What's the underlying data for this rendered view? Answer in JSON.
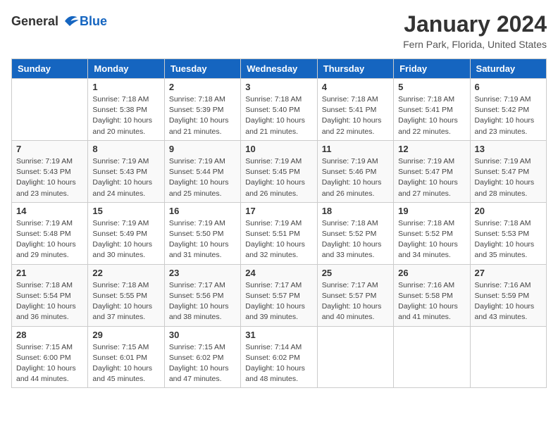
{
  "logo": {
    "general": "General",
    "blue": "Blue"
  },
  "title": "January 2024",
  "location": "Fern Park, Florida, United States",
  "days_of_week": [
    "Sunday",
    "Monday",
    "Tuesday",
    "Wednesday",
    "Thursday",
    "Friday",
    "Saturday"
  ],
  "weeks": [
    [
      {
        "day": "",
        "info": ""
      },
      {
        "day": "1",
        "info": "Sunrise: 7:18 AM\nSunset: 5:38 PM\nDaylight: 10 hours\nand 20 minutes."
      },
      {
        "day": "2",
        "info": "Sunrise: 7:18 AM\nSunset: 5:39 PM\nDaylight: 10 hours\nand 21 minutes."
      },
      {
        "day": "3",
        "info": "Sunrise: 7:18 AM\nSunset: 5:40 PM\nDaylight: 10 hours\nand 21 minutes."
      },
      {
        "day": "4",
        "info": "Sunrise: 7:18 AM\nSunset: 5:41 PM\nDaylight: 10 hours\nand 22 minutes."
      },
      {
        "day": "5",
        "info": "Sunrise: 7:18 AM\nSunset: 5:41 PM\nDaylight: 10 hours\nand 22 minutes."
      },
      {
        "day": "6",
        "info": "Sunrise: 7:19 AM\nSunset: 5:42 PM\nDaylight: 10 hours\nand 23 minutes."
      }
    ],
    [
      {
        "day": "7",
        "info": "Sunrise: 7:19 AM\nSunset: 5:43 PM\nDaylight: 10 hours\nand 23 minutes."
      },
      {
        "day": "8",
        "info": "Sunrise: 7:19 AM\nSunset: 5:43 PM\nDaylight: 10 hours\nand 24 minutes."
      },
      {
        "day": "9",
        "info": "Sunrise: 7:19 AM\nSunset: 5:44 PM\nDaylight: 10 hours\nand 25 minutes."
      },
      {
        "day": "10",
        "info": "Sunrise: 7:19 AM\nSunset: 5:45 PM\nDaylight: 10 hours\nand 26 minutes."
      },
      {
        "day": "11",
        "info": "Sunrise: 7:19 AM\nSunset: 5:46 PM\nDaylight: 10 hours\nand 26 minutes."
      },
      {
        "day": "12",
        "info": "Sunrise: 7:19 AM\nSunset: 5:47 PM\nDaylight: 10 hours\nand 27 minutes."
      },
      {
        "day": "13",
        "info": "Sunrise: 7:19 AM\nSunset: 5:47 PM\nDaylight: 10 hours\nand 28 minutes."
      }
    ],
    [
      {
        "day": "14",
        "info": "Sunrise: 7:19 AM\nSunset: 5:48 PM\nDaylight: 10 hours\nand 29 minutes."
      },
      {
        "day": "15",
        "info": "Sunrise: 7:19 AM\nSunset: 5:49 PM\nDaylight: 10 hours\nand 30 minutes."
      },
      {
        "day": "16",
        "info": "Sunrise: 7:19 AM\nSunset: 5:50 PM\nDaylight: 10 hours\nand 31 minutes."
      },
      {
        "day": "17",
        "info": "Sunrise: 7:19 AM\nSunset: 5:51 PM\nDaylight: 10 hours\nand 32 minutes."
      },
      {
        "day": "18",
        "info": "Sunrise: 7:18 AM\nSunset: 5:52 PM\nDaylight: 10 hours\nand 33 minutes."
      },
      {
        "day": "19",
        "info": "Sunrise: 7:18 AM\nSunset: 5:52 PM\nDaylight: 10 hours\nand 34 minutes."
      },
      {
        "day": "20",
        "info": "Sunrise: 7:18 AM\nSunset: 5:53 PM\nDaylight: 10 hours\nand 35 minutes."
      }
    ],
    [
      {
        "day": "21",
        "info": "Sunrise: 7:18 AM\nSunset: 5:54 PM\nDaylight: 10 hours\nand 36 minutes."
      },
      {
        "day": "22",
        "info": "Sunrise: 7:18 AM\nSunset: 5:55 PM\nDaylight: 10 hours\nand 37 minutes."
      },
      {
        "day": "23",
        "info": "Sunrise: 7:17 AM\nSunset: 5:56 PM\nDaylight: 10 hours\nand 38 minutes."
      },
      {
        "day": "24",
        "info": "Sunrise: 7:17 AM\nSunset: 5:57 PM\nDaylight: 10 hours\nand 39 minutes."
      },
      {
        "day": "25",
        "info": "Sunrise: 7:17 AM\nSunset: 5:57 PM\nDaylight: 10 hours\nand 40 minutes."
      },
      {
        "day": "26",
        "info": "Sunrise: 7:16 AM\nSunset: 5:58 PM\nDaylight: 10 hours\nand 41 minutes."
      },
      {
        "day": "27",
        "info": "Sunrise: 7:16 AM\nSunset: 5:59 PM\nDaylight: 10 hours\nand 43 minutes."
      }
    ],
    [
      {
        "day": "28",
        "info": "Sunrise: 7:15 AM\nSunset: 6:00 PM\nDaylight: 10 hours\nand 44 minutes."
      },
      {
        "day": "29",
        "info": "Sunrise: 7:15 AM\nSunset: 6:01 PM\nDaylight: 10 hours\nand 45 minutes."
      },
      {
        "day": "30",
        "info": "Sunrise: 7:15 AM\nSunset: 6:02 PM\nDaylight: 10 hours\nand 47 minutes."
      },
      {
        "day": "31",
        "info": "Sunrise: 7:14 AM\nSunset: 6:02 PM\nDaylight: 10 hours\nand 48 minutes."
      },
      {
        "day": "",
        "info": ""
      },
      {
        "day": "",
        "info": ""
      },
      {
        "day": "",
        "info": ""
      }
    ]
  ]
}
